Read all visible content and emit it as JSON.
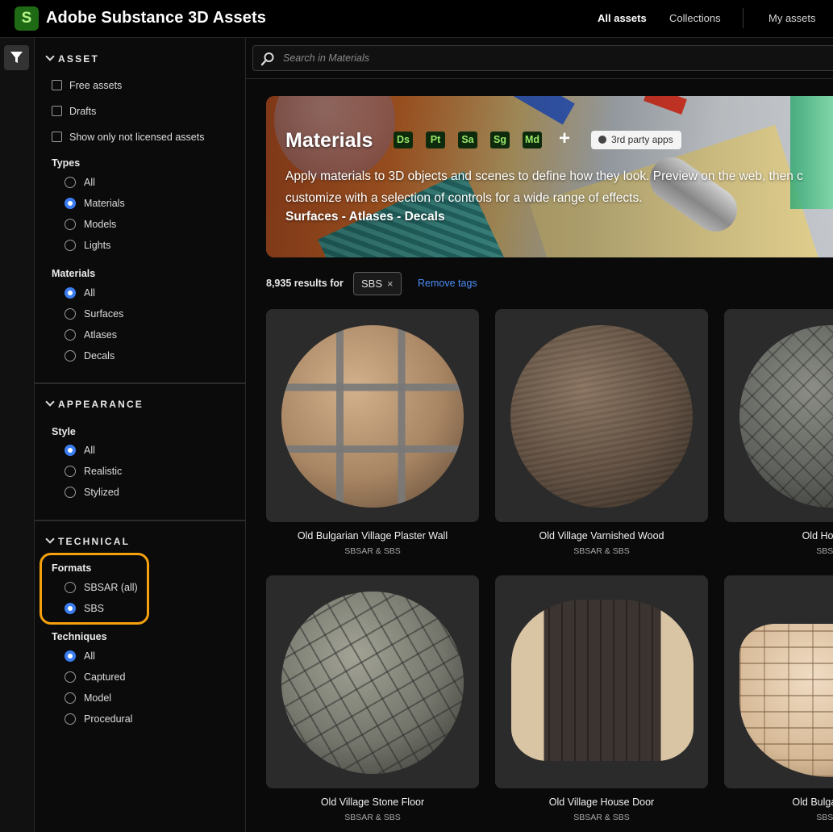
{
  "header": {
    "logo_letter": "S",
    "app_title": "Adobe Substance 3D Assets",
    "nav": [
      {
        "label": "All assets",
        "active": true
      },
      {
        "label": "Collections",
        "active": false
      },
      {
        "label": "My assets",
        "active": false
      }
    ]
  },
  "rail": {
    "filter_icon": "filter-icon"
  },
  "sidebar": {
    "asset": {
      "heading": "ASSET",
      "checkboxes": [
        "Free assets",
        "Drafts",
        "Show only not licensed assets"
      ],
      "types_label": "Types",
      "types": [
        "All",
        "Materials",
        "Models",
        "Lights"
      ],
      "types_selected": "Materials",
      "materials_label": "Materials",
      "materials": [
        "All",
        "Surfaces",
        "Atlases",
        "Decals"
      ],
      "materials_selected": "All"
    },
    "appearance": {
      "heading": "APPEARANCE",
      "style_label": "Style",
      "styles": [
        "All",
        "Realistic",
        "Stylized"
      ],
      "style_selected": "All"
    },
    "technical": {
      "heading": "TECHNICAL",
      "formats_label": "Formats",
      "formats": [
        "SBSAR (all)",
        "SBS"
      ],
      "format_selected": "SBS",
      "techniques_label": "Techniques",
      "techniques": [
        "All",
        "Captured",
        "Model",
        "Procedural"
      ],
      "technique_selected": "All"
    },
    "highlight_color": "#f5a10e"
  },
  "search": {
    "placeholder": "Search in Materials"
  },
  "banner": {
    "title": "Materials",
    "apps": [
      "Ds",
      "Pt",
      "Sa",
      "Sg",
      "Md"
    ],
    "plus": "+",
    "third_party": "3rd party apps",
    "description_line1": "Apply materials to 3D objects and scenes to define how they look. Preview on the web, then c",
    "description_line2": "customize with a selection of controls for a wide range of effects.",
    "links": "Surfaces - Atlases - Decals"
  },
  "results": {
    "count_text": "8,935 results for",
    "tag": "SBS",
    "tag_remove": "×",
    "remove_tags": "Remove tags"
  },
  "cards": [
    {
      "name": "Old Bulgarian Village Plaster Wall",
      "formats": "SBSAR & SBS"
    },
    {
      "name": "Old Village Varnished Wood",
      "formats": "SBSAR & SBS"
    },
    {
      "name": "Old House S",
      "formats": "SBSAR"
    },
    {
      "name": "Old Village Stone Floor",
      "formats": "SBSAR & SBS"
    },
    {
      "name": "Old Village House Door",
      "formats": "SBSAR & SBS"
    },
    {
      "name": "Old Bulgarian Ho",
      "formats": "SBSAR"
    }
  ],
  "colors": {
    "accent_blue": "#3b7df0",
    "link_blue": "#4b8cf5",
    "app_badge_green": "#9ae86a"
  }
}
